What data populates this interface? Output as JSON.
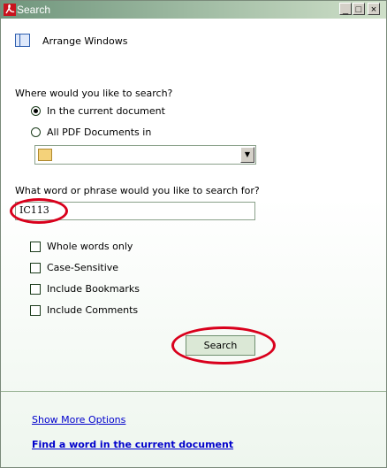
{
  "window": {
    "title": "Search",
    "minimize_glyph": "_",
    "maximize_glyph": "□",
    "close_glyph": "×"
  },
  "top": {
    "arrange_windows_label": "Arrange Windows"
  },
  "where": {
    "question": "Where would you like to search?",
    "options": [
      {
        "label": "In the current document",
        "selected": true
      },
      {
        "label": "All PDF Documents in",
        "selected": false
      }
    ],
    "location_value": ""
  },
  "what": {
    "question": "What word or phrase would you like to search for?",
    "query": "IC113"
  },
  "options": {
    "checkboxes": [
      {
        "label": "Whole words only",
        "checked": false
      },
      {
        "label": "Case-Sensitive",
        "checked": false
      },
      {
        "label": "Include Bookmarks",
        "checked": false
      },
      {
        "label": "Include Comments",
        "checked": false
      }
    ]
  },
  "actions": {
    "search_label": "Search"
  },
  "links": {
    "more_options": "Show More Options",
    "find_word": "Find a word in the current document"
  },
  "colors": {
    "accent_ring": "#d9001c",
    "title_gradient_start": "#6f957c",
    "link": "#0000cc"
  }
}
